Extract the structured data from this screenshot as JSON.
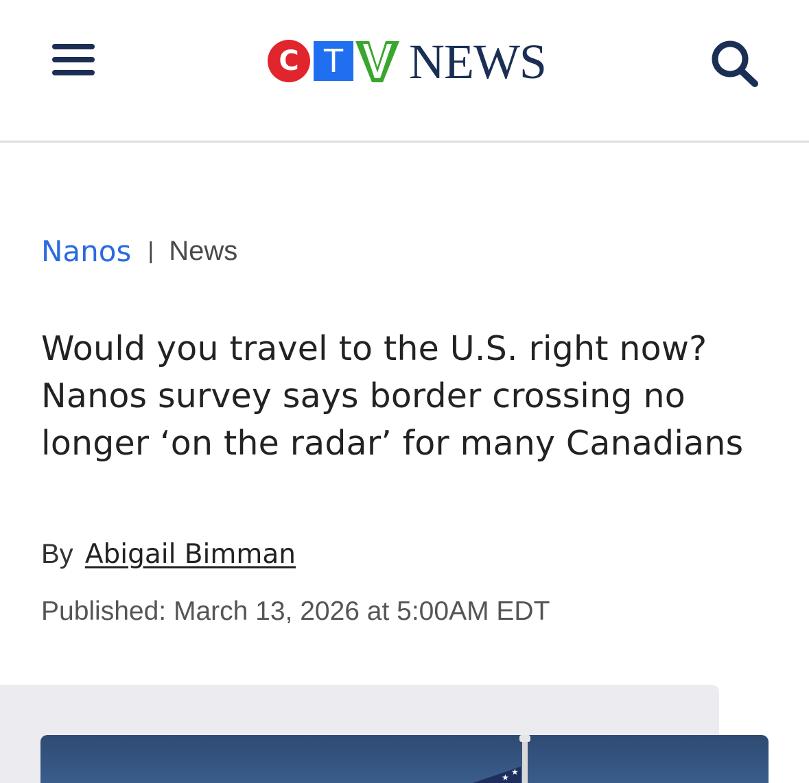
{
  "header": {
    "logo": {
      "c": "C",
      "t": "T",
      "v": "V",
      "news": "NEWS",
      "colors": {
        "c": "#e0262c",
        "t": "#1f6ff0",
        "v": "#3aa62e",
        "news": "#1b2f55"
      }
    },
    "menu_icon": "hamburger-menu-icon",
    "search_icon": "search-icon"
  },
  "category": {
    "primary": "Nanos",
    "separator": "|",
    "secondary": "News",
    "primary_color": "#2a6ae0"
  },
  "article": {
    "headline": "Would you travel to the U.S. right now? Nanos survey says border crossing no longer ‘on the radar’ for many Canadians",
    "byline_prefix": "By",
    "author": "Abigail Bimman",
    "published": "Published: March 13, 2026 at 5:00AM EDT"
  },
  "media": {
    "image_icon": "american-flag-on-pole-icon"
  }
}
